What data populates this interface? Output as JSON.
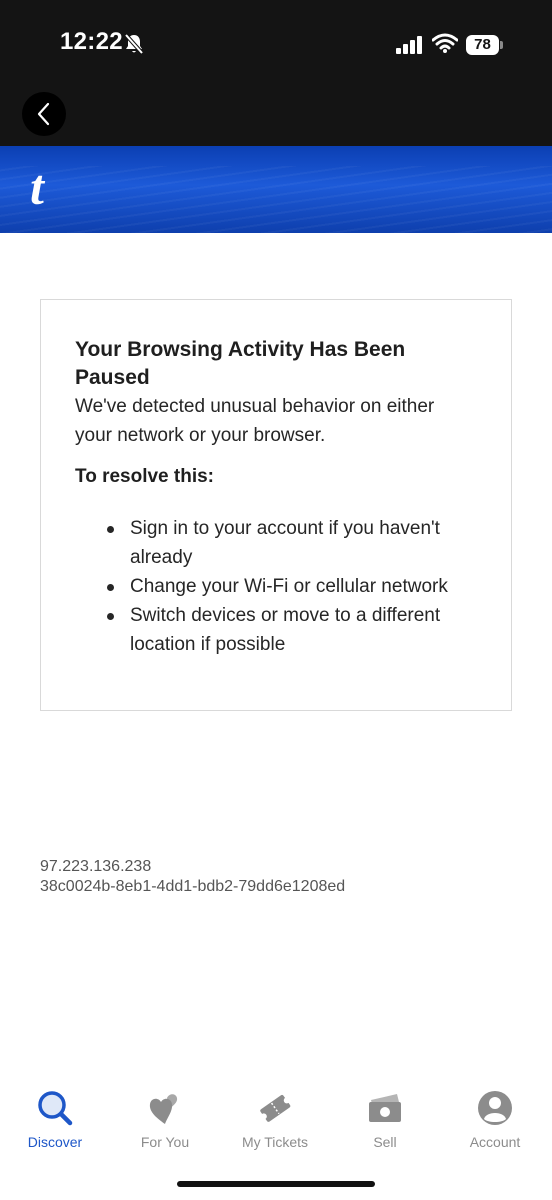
{
  "status_bar": {
    "time": "12:22",
    "battery": "78",
    "icons": [
      "bell-off-icon",
      "signal-icon",
      "wifi-icon",
      "battery-icon"
    ]
  },
  "nav": {
    "back_icon": "chevron-left-icon"
  },
  "brand": {
    "logo": "t",
    "color": "#1d5ad8"
  },
  "card": {
    "title": "Your Browsing Activity Has Been Paused",
    "description": "We've detected unusual behavior on either your network or your browser.",
    "subheading": "To resolve this:",
    "steps": [
      "Sign in to your account if you haven't already",
      "Change your Wi-Fi or cellular network",
      "Switch devices or move to a different location if possible"
    ]
  },
  "debug": {
    "ip": "97.223.136.238",
    "request_id": "38c0024b-8eb1-4dd1-bdb2-79dd6e1208ed"
  },
  "tab_bar": {
    "active_color": "#1e57c8",
    "inactive_color": "#8c8c8c",
    "tabs": [
      {
        "label": "Discover",
        "icon": "search-icon",
        "active": true
      },
      {
        "label": "For You",
        "icon": "hearts-icon",
        "active": false
      },
      {
        "label": "My Tickets",
        "icon": "ticket-icon",
        "active": false
      },
      {
        "label": "Sell",
        "icon": "cash-icon",
        "active": false
      },
      {
        "label": "Account",
        "icon": "user-icon",
        "active": false
      }
    ]
  }
}
